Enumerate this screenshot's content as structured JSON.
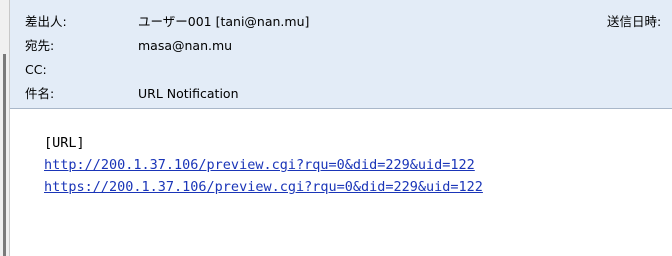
{
  "header": {
    "from": {
      "label": "差出人:",
      "value": "ユーザー001 [tani@nan.mu]"
    },
    "sent": {
      "label": "送信日時:"
    },
    "to": {
      "label": "宛先:",
      "value": "masa@nan.mu"
    },
    "cc": {
      "label": "CC:",
      "value": ""
    },
    "subject": {
      "label": "件名:",
      "value": "URL Notification"
    }
  },
  "body": {
    "lines": [
      {
        "text": "[URL]",
        "is_link": false
      },
      {
        "text": "http://200.1.37.106/preview.cgi?rqu=0&did=229&uid=122",
        "is_link": true
      },
      {
        "text": "https://200.1.37.106/preview.cgi?rqu=0&did=229&uid=122",
        "is_link": true
      }
    ]
  },
  "colors": {
    "header_background": "#e3ecf7",
    "link": "#1a35b8"
  }
}
